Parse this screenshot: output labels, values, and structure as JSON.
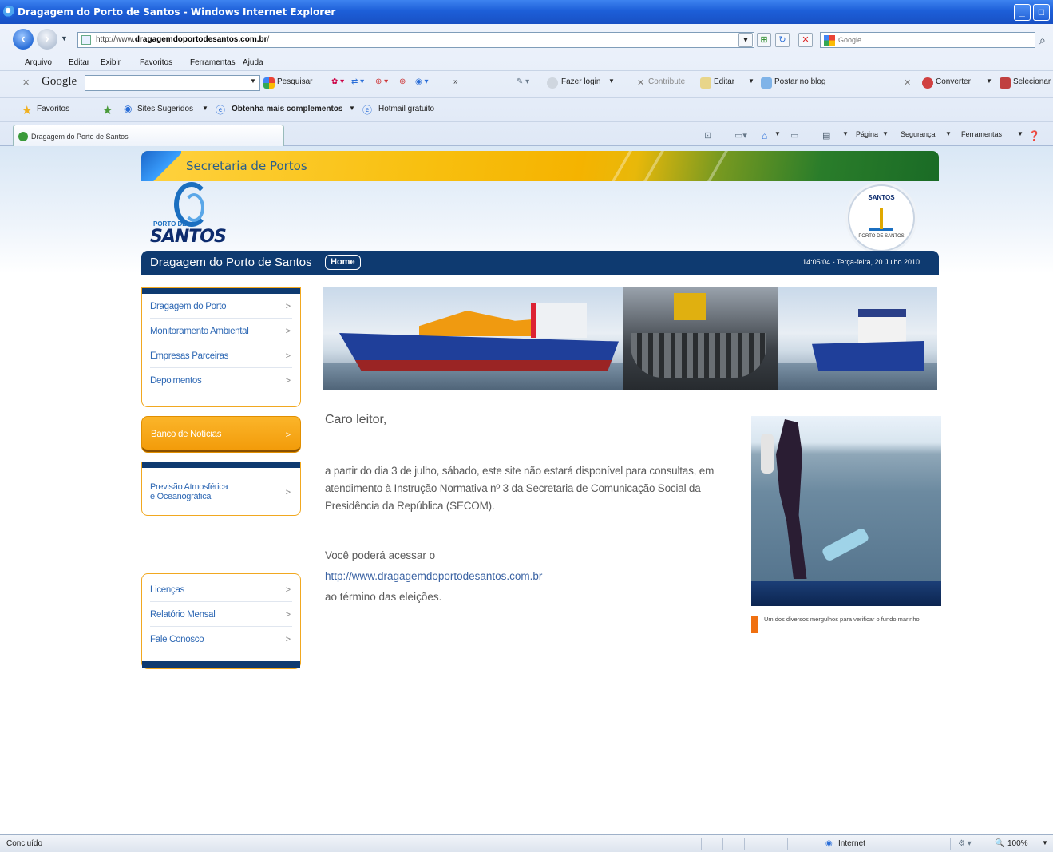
{
  "window": {
    "title": "Dragagem do Porto de Santos - Windows Internet Explorer"
  },
  "address": {
    "url_prefix": "http://www.",
    "url_domain": "dragagemdoportodesantos.com.br",
    "url_suffix": "/"
  },
  "google_search_placeholder": "Google",
  "menu": [
    "Arquivo",
    "Editar",
    "Exibir",
    "Favoritos",
    "Ferramentas",
    "Ajuda"
  ],
  "google_toolbar": {
    "logo": "Google",
    "pesquisar": "Pesquisar",
    "more": "»",
    "fazer_login": "Fazer login",
    "contribute": "Contribute",
    "editar": "Editar",
    "postar": "Postar no blog",
    "converter": "Converter",
    "selecionar": "Selecionar"
  },
  "favorites": {
    "label": "Favoritos",
    "sites": "Sites Sugeridos",
    "obtenha": "Obtenha mais complementos",
    "hotmail": "Hotmail gratuito"
  },
  "tab": {
    "label": "Dragagem do Porto de Santos"
  },
  "commandbar": {
    "pagina": "Página",
    "seguranca": "Segurança",
    "ferramentas": "Ferramentas"
  },
  "site": {
    "ministry": "Secretaria de Portos",
    "logo_top": "PORTO DE",
    "logo_name": "SANTOS",
    "seal_name": "SANTOS",
    "seal_sub": "PORTO DE SANTOS",
    "title": "Dragagem do Porto de Santos",
    "home": "Home",
    "datetime": "14:05:04 - Terça-feira, 20 Julho 2010"
  },
  "left_menu_1": [
    {
      "label": "Dragagem do Porto"
    },
    {
      "label": "Monitoramento Ambiental"
    },
    {
      "label": "Empresas Parceiras"
    },
    {
      "label": "Depoimentos"
    }
  ],
  "left_menu_2": {
    "label": "Banco de Notícias"
  },
  "left_menu_3": {
    "line1": "Previsão Atmosférica",
    "line2": "e Oceanográfica"
  },
  "left_menu_4": [
    {
      "label": "Licenças"
    },
    {
      "label": "Relatório Mensal"
    },
    {
      "label": "Fale Conosco"
    }
  ],
  "arrow": ">",
  "content": {
    "greeting": "Caro leitor,",
    "paragraph": "a partir do dia 3 de julho, sábado, este site não estará disponível para consultas, em atendimento à Instrução Normativa nº 3 da Secretaria de Comunicação Social da Presidência da República (SECOM).",
    "line1": "Você poderá acessar o",
    "link": "http://www.dragagemdoportodesantos.com.br",
    "line3": "ao término das eleições."
  },
  "photo_caption": "Um dos diversos mergulhos para verificar o fundo marinho",
  "status": {
    "left": "Concluído",
    "zone": "Internet",
    "zoom": "100%"
  }
}
